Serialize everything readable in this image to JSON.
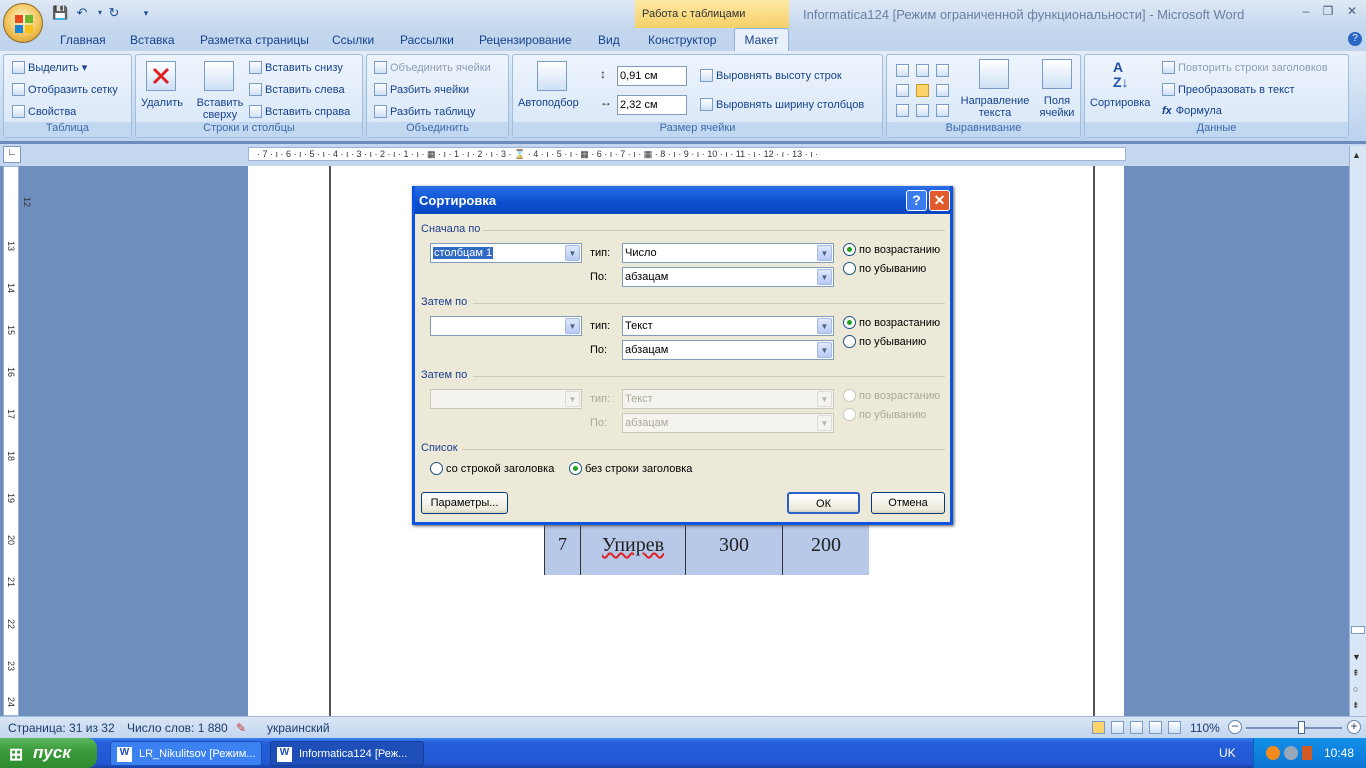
{
  "titlebar": {
    "context_tab": "Работа с таблицами",
    "doc_title": "Informatica124 [Режим ограниченной функциональности] - Microsoft Word",
    "min": "–",
    "restore": "❐",
    "close": "✕",
    "help": "?"
  },
  "ribbon_tabs": [
    "Главная",
    "Вставка",
    "Разметка страницы",
    "Ссылки",
    "Рассылки",
    "Рецензирование",
    "Вид",
    "Конструктор"
  ],
  "active_tab": "Макет",
  "groups": {
    "table": {
      "title": "Таблица",
      "select": "Выделить ▾",
      "grid": "Отобразить сетку",
      "props": "Свойства"
    },
    "rowscols": {
      "title": "Строки и столбцы",
      "delete": "Удалить",
      "insert_above": "Вставить сверху",
      "insert_below": "Вставить снизу",
      "insert_left": "Вставить слева",
      "insert_right": "Вставить справа"
    },
    "merge": {
      "title": "Объединить",
      "merge_cells": "Объединить ячейки",
      "split_cells": "Разбить ячейки",
      "split_table": "Разбить таблицу"
    },
    "cellsize": {
      "title": "Размер ячейки",
      "autofit": "Автоподбор",
      "height": "0,91 см",
      "width": "2,32 см",
      "dist_rows": "Выровнять высоту строк",
      "dist_cols": "Выровнять ширину столбцов"
    },
    "align": {
      "title": "Выравнивание",
      "direction": "Направление текста",
      "margins": "Поля ячейки"
    },
    "data": {
      "title": "Данные",
      "sort": "Сортировка",
      "repeat": "Повторить строки заголовков",
      "convert": "Преобразовать в текст",
      "formula": "Формула"
    }
  },
  "ruler_text": "· 7 · ı · 6 · ı · 5 · ı · 4 · ı · 3 · ı · 2 · ı · 1 · ı · ▦ · ı · 1 · ı · 2 · ı · 3 · ⌛ · 4 · ı · 5 · ı · ▦ · 6 · ı · 7 · ı · ▦ · 8 · ı · 9 · ı · 10 · ı · 11 · ı · 12 · ı · 13 · ı ·",
  "vruler_numbers": [
    "12",
    "13",
    "14",
    "15",
    "16",
    "17",
    "18",
    "19",
    "20",
    "21",
    "22",
    "23",
    "24"
  ],
  "table_row": {
    "num": "7",
    "name": "Упирев",
    "a": "300",
    "b": "200"
  },
  "dialog": {
    "title": "Сортировка",
    "first": {
      "label": "Сначала по",
      "column": "столбцам 1",
      "type_label": "тип:",
      "type": "Число",
      "by_label": "По:",
      "by": "абзацам",
      "asc": "по возрастанию",
      "desc": "по убыванию"
    },
    "then1": {
      "label": "Затем по",
      "column": "",
      "type_label": "тип:",
      "type": "Текст",
      "by_label": "По:",
      "by": "абзацам",
      "asc": "по возрастанию",
      "desc": "по убыванию"
    },
    "then2": {
      "label": "Затем по",
      "column": "",
      "type_label": "тип:",
      "type": "Текст",
      "by_label": "По:",
      "by": "абзацам",
      "asc": "по возрастанию",
      "desc": "по убыванию"
    },
    "list": {
      "label": "Список",
      "with_header": "со строкой заголовка",
      "no_header": "без строки заголовка"
    },
    "params": "Параметры...",
    "ok": "ОК",
    "cancel": "Отмена"
  },
  "status": {
    "page": "Страница: 31 из 32",
    "words": "Число слов: 1 880",
    "lang": "украинский",
    "zoom": "110%",
    "zoom_level_pct": 58
  },
  "taskbar": {
    "start": "пуск",
    "task1": "LR_Nikulitsov [Режим...",
    "task2": "Informatica124 [Реж...",
    "lang": "UK",
    "clock": "10:48"
  }
}
